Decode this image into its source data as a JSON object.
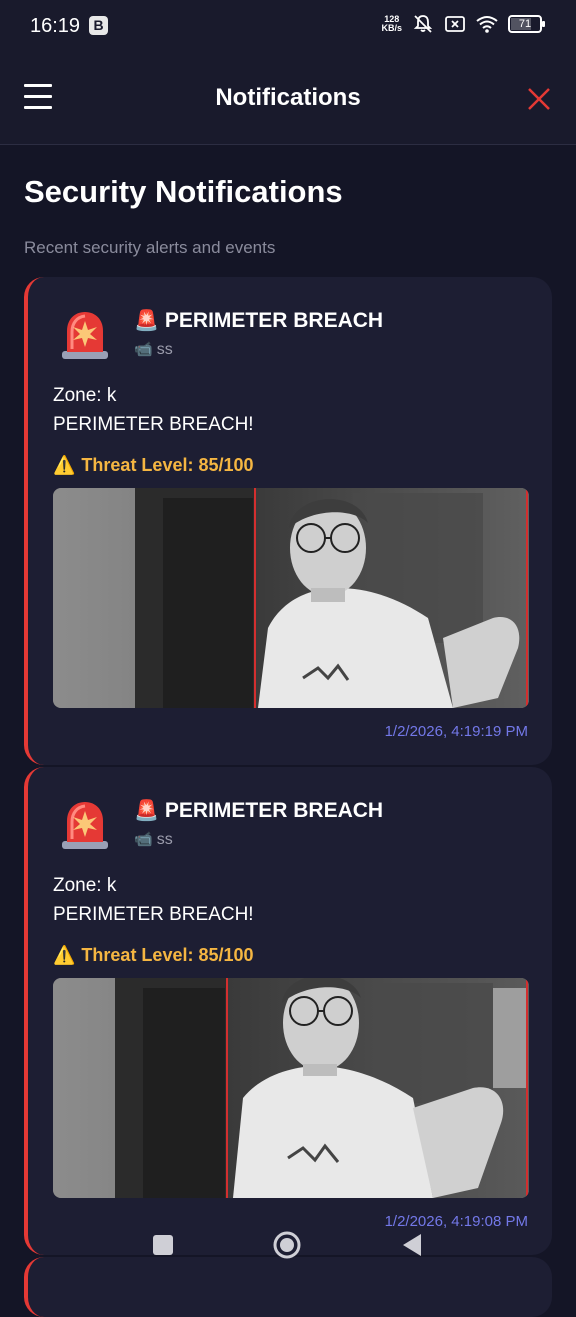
{
  "status_bar": {
    "time": "16:19",
    "b_badge": "B",
    "net_speed_top": "128",
    "net_speed_unit": "KB/s",
    "battery": "71",
    "battery_level": 0.71,
    "icons": [
      "mute-icon",
      "sim-x-icon",
      "wifi-icon",
      "battery-icon"
    ]
  },
  "app_bar": {
    "title": "Notifications",
    "menu_icon": "hamburger-icon",
    "close_icon": "close-icon",
    "accent": "#e53935"
  },
  "page": {
    "title": "Security Notifications",
    "subtitle": "Recent security alerts and events"
  },
  "notifications": [
    {
      "icon": "police-light-icon",
      "title_emoji": "🚨",
      "title": "PERIMETER BREACH",
      "camera_emoji": "📹",
      "camera": "ss",
      "zone": "Zone: k",
      "message": "PERIMETER BREACH!",
      "threat_emoji": "⚠️",
      "threat": "Threat Level: 85/100",
      "timestamp": "1/2/2026, 4:19:19 PM"
    },
    {
      "icon": "police-light-icon",
      "title_emoji": "🚨",
      "title": "PERIMETER BREACH",
      "camera_emoji": "📹",
      "camera": "ss",
      "zone": "Zone: k",
      "message": "PERIMETER BREACH!",
      "threat_emoji": "⚠️",
      "threat": "Threat Level: 85/100",
      "timestamp": "1/2/2026, 4:19:08 PM"
    }
  ],
  "nav_bar": {
    "recents_icon": "square-icon",
    "home_icon": "circle-icon",
    "back_icon": "back-triangle-icon"
  },
  "colors": {
    "background": "#141526",
    "card": "#1d1e33",
    "alert_border": "#e53935",
    "threat": "#f5b642",
    "timestamp": "#7378e8"
  }
}
